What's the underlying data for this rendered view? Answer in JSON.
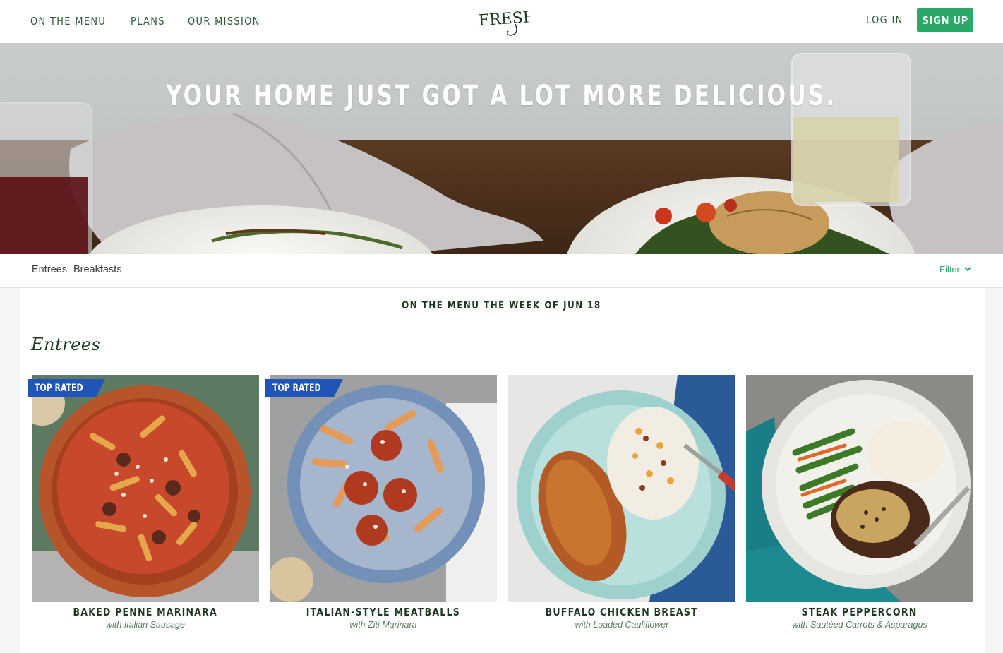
{
  "header": {
    "nav": [
      "ON THE MENU",
      "PLANS",
      "OUR MISSION"
    ],
    "logo_text": "FRESHLY",
    "login_label": "LOG IN",
    "signup_label": "SIGN UP",
    "brand_color": "#2aa868"
  },
  "hero": {
    "headline": "YOUR HOME JUST GOT A LOT MORE DELICIOUS."
  },
  "category_bar": {
    "tabs": [
      "Entrees",
      "Breakfasts"
    ],
    "filter_label": "Filter",
    "filter_icon": "chevron-down-icon"
  },
  "menu": {
    "week_title": "ON THE MENU THE WEEK OF JUN 18",
    "section_heading": "Entrees",
    "meals": [
      {
        "badge": "TOP RATED",
        "name": "BAKED PENNE MARINARA",
        "subtitle": "with Italian Sausage"
      },
      {
        "badge": "TOP RATED",
        "name": "ITALIAN-STYLE MEATBALLS",
        "subtitle": "with Ziti Marinara"
      },
      {
        "badge": "",
        "name": "BUFFALO CHICKEN BREAST",
        "subtitle": "with Loaded Cauliflower"
      },
      {
        "badge": "",
        "name": "STEAK PEPPERCORN",
        "subtitle": "with Sautéed Carrots & Asparagus"
      }
    ],
    "badge_color": "#1f55b6"
  }
}
